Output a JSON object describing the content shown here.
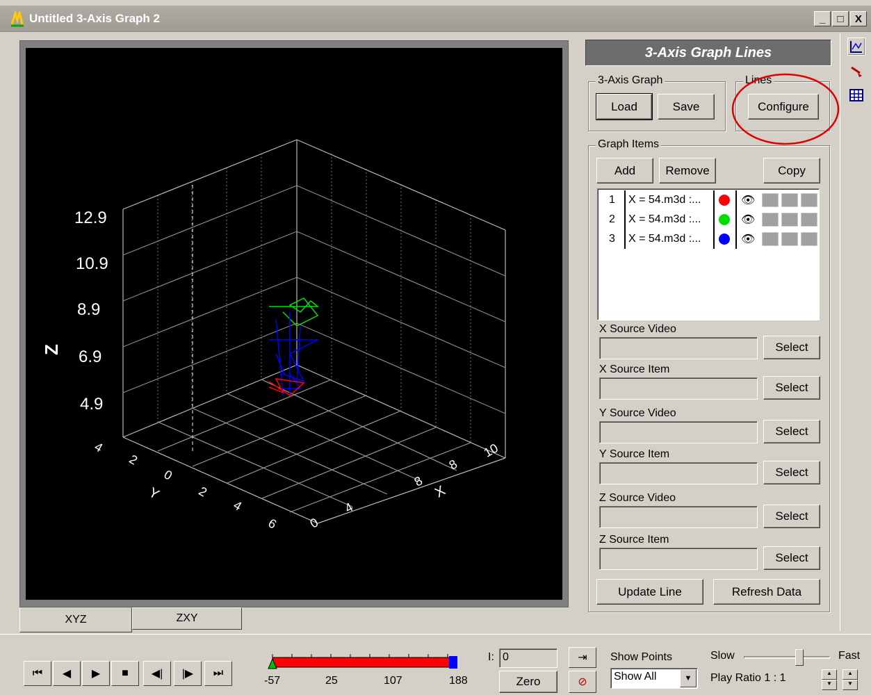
{
  "window": {
    "title": "Untitled 3-Axis Graph 2",
    "min": "_",
    "max": "□",
    "close": "X"
  },
  "graph": {
    "z_axis_label": "Z",
    "z_ticks": [
      "12.9",
      "10.9",
      "8.9",
      "6.9",
      "4.9"
    ],
    "y_axis_label": "Y",
    "y_ticks": [
      "4",
      "2",
      "0",
      "2",
      "4",
      "6"
    ],
    "x_axis_label": "X",
    "x_ticks": [
      "0",
      "4",
      "8",
      "8",
      "10"
    ]
  },
  "tabs": {
    "xyz": "XYZ",
    "zxy": "ZXY"
  },
  "panel": {
    "header": "3-Axis Graph Lines",
    "graph_group": "3-Axis Graph",
    "load": "Load",
    "save": "Save",
    "lines_group": "Lines",
    "configure": "Configure",
    "items_group": "Graph Items",
    "add": "Add",
    "remove": "Remove",
    "copy": "Copy",
    "items": [
      {
        "num": "1",
        "name": "X = 54.m3d :...",
        "color": "#ff0000"
      },
      {
        "num": "2",
        "name": "X = 54.m3d :...",
        "color": "#00e000"
      },
      {
        "num": "3",
        "name": "X = 54.m3d :...",
        "color": "#0000ff"
      }
    ],
    "x_source_video": "X Source Video",
    "x_source_item": "X Source Item",
    "y_source_video": "Y Source Video",
    "y_source_item": "Y Source Item",
    "z_source_video": "Z Source Video",
    "z_source_item": "Z Source Item",
    "select": "Select",
    "update_line": "Update Line",
    "refresh_data": "Refresh Data"
  },
  "playback": {
    "range_start": "-57",
    "range_mid1": "25",
    "range_mid2": "107",
    "range_end": "188",
    "index_label": "I:",
    "index_value": "0",
    "zero": "Zero",
    "show_points_label": "Show Points",
    "show_points_value": "Show All",
    "slow": "Slow",
    "fast": "Fast",
    "play_ratio": "Play Ratio  1 :  1"
  }
}
